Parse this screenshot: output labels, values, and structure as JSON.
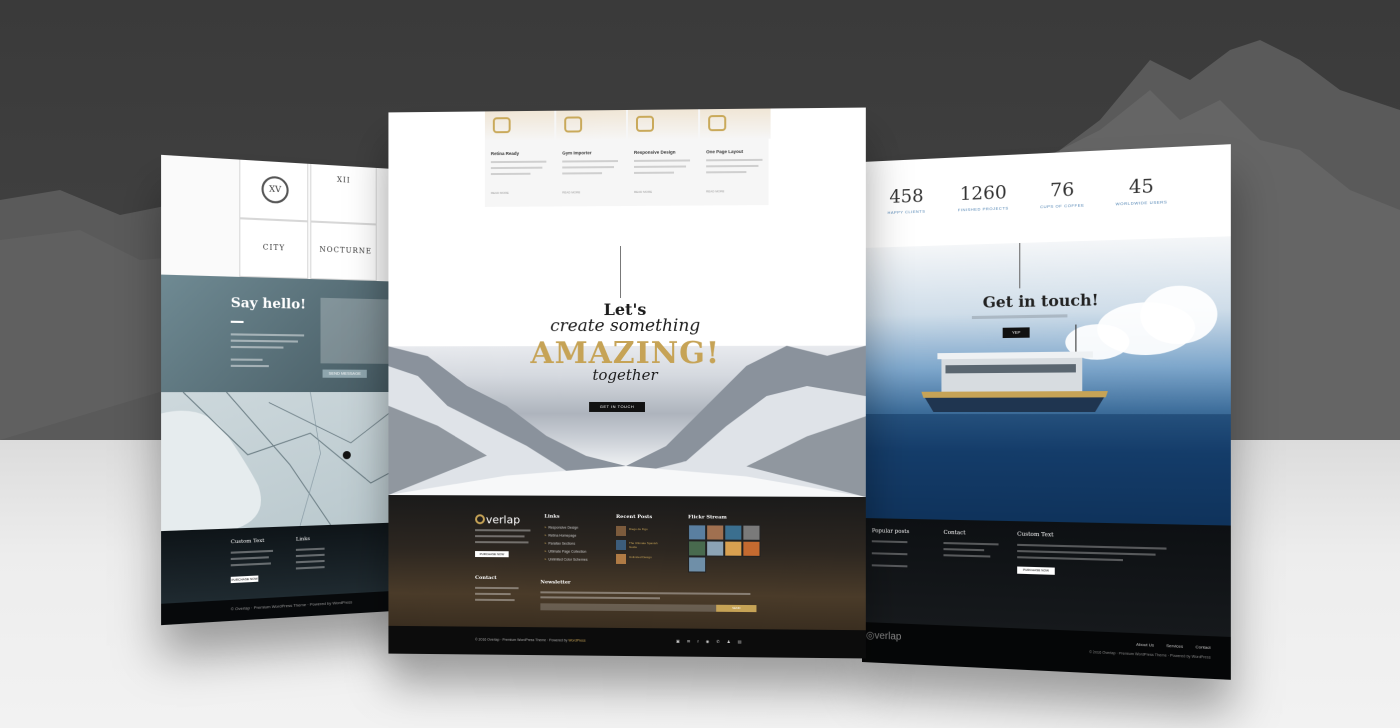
{
  "left_mockup": {
    "logo_texts": [
      "XV",
      "XII",
      "CITY",
      "NOCTURNE"
    ],
    "say_hello": "Say hello!",
    "send_button": "SEND MESSAGE",
    "footer_heading_1": "Custom Text",
    "footer_heading_2": "Links",
    "footer_button": "PURCHASE NOW",
    "copyright": "© Overlap · Premium WordPress Theme · Powered by WordPress"
  },
  "center_mockup": {
    "features": [
      {
        "title": "Retina Ready",
        "more": "READ MORE"
      },
      {
        "title": "Gym Importer",
        "more": "READ MORE"
      },
      {
        "title": "Responsive Design",
        "more": "READ MORE"
      },
      {
        "title": "One Page Layout",
        "more": "READ MORE"
      }
    ],
    "hero": {
      "line1": "Let's",
      "line2": "create something",
      "line3": "AMAZING!",
      "line4": "together",
      "cta": "GET IN TOUCH"
    },
    "footer": {
      "logo": "verlap",
      "purchase": "PURCHASE NOW",
      "links_heading": "Links",
      "links": [
        "Responsive Design",
        "Retina Homepage",
        "Parallax Sections",
        "Ultimate Page Collection",
        "Unlimited Color Schemes"
      ],
      "posts_heading": "Recent Posts",
      "posts": [
        "Diego de Figo",
        "The Ultimate Spanish Guide",
        "Unlimited Design"
      ],
      "flickr_heading": "Flickr Stream",
      "contact_heading": "Contact",
      "newsletter_heading": "Newsletter",
      "newsletter_button": "SEND",
      "copyright_pre": "© 2016 Overlap · Premium WordPress Theme · Powered by",
      "copyright_link": "WordPress",
      "social": "▣ ✉ f ◉ ✆ ♟ ▤"
    },
    "accent_color": "#c6a356"
  },
  "right_mockup": {
    "stats": [
      {
        "num": "458",
        "label": "HAPPY CLIENTS"
      },
      {
        "num": "1260",
        "label": "FINISHED PROJECTS"
      },
      {
        "num": "76",
        "label": "CUPS OF COFFEE"
      },
      {
        "num": "45",
        "label": "WORLDWIDE USERS"
      }
    ],
    "touch_title": "Get in touch!",
    "touch_button": "YEP",
    "footer_popular": "Popular posts",
    "footer_contact": "Contact",
    "footer_custom": "Custom Text",
    "footer_button": "PURCHASE NOW",
    "logo": "verlap",
    "nav": [
      "About Us",
      "Services",
      "Contact"
    ],
    "copyright": "© 2016 Overlap · Premium WordPress Theme · Powered by WordPress"
  }
}
